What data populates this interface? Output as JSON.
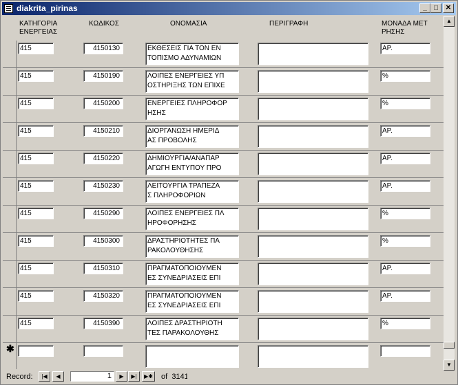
{
  "window": {
    "title": "diakrita_pirinas",
    "minimize": "_",
    "maximize": "□",
    "close": "✕"
  },
  "headers": {
    "category": "ΚΑΤΗΓΟΡΙΑ\nΕΝΕΡΓΕΙΑΣ",
    "code": "ΚΩΔΙΚΟΣ",
    "name": "ΟΝΟΜΑΣΙΑ",
    "description": "ΠΕΡΙΓΡΑΦΗ",
    "unit": "ΜΟΝΑΔΑ ΜΕΤ\nΡΗΣΗΣ"
  },
  "rows": [
    {
      "category": "415",
      "code": "4150130",
      "name": "ΕΚΘΕΣΕΙΣ ΓΙΑ ΤΟΝ ΕΝ\nΤΟΠΙΣΜΟ ΑΔΥΝΑΜΙΩΝ",
      "description": "",
      "unit": "ΑΡ."
    },
    {
      "category": "415",
      "code": "4150190",
      "name": "ΛΟΙΠΕΣ ΕΝΕΡΓΕΙΕΣ ΥΠ\nΟΣΤΗΡΙΞΗΣ ΤΩΝ ΕΠΙΧΕ",
      "description": "",
      "unit": "%"
    },
    {
      "category": "415",
      "code": "4150200",
      "name": "ΕΝΕΡΓΕΙΕΣ ΠΛΗΡΟΦΟΡ\nΗΣΗΣ",
      "description": "",
      "unit": "%"
    },
    {
      "category": "415",
      "code": "4150210",
      "name": "ΔΙΟΡΓΑΝΩΣΗ ΗΜΕΡΙΔ\nΑΣ ΠΡΟΒΟΛΗΣ",
      "description": "",
      "unit": "ΑΡ."
    },
    {
      "category": "415",
      "code": "4150220",
      "name": "ΔΗΜΙΟΥΡΓΙΑ/ΑΝΑΠΑΡ\nΑΓΩΓΗ ΕΝΤΥΠΟΥ ΠΡΟ",
      "description": "",
      "unit": "ΑΡ."
    },
    {
      "category": "415",
      "code": "4150230",
      "name": "ΛΕΙΤΟΥΡΓΙΑ ΤΡΑΠΕΖΑ\nΣ ΠΛΗΡΟΦΟΡΙΩΝ",
      "description": "",
      "unit": "ΑΡ."
    },
    {
      "category": "415",
      "code": "4150290",
      "name": "ΛΟΙΠΕΣ ΕΝΕΡΓΕΙΕΣ ΠΛ\nΗΡΟΦΟΡΗΣΗΣ",
      "description": "",
      "unit": "%"
    },
    {
      "category": "415",
      "code": "4150300",
      "name": "ΔΡΑΣΤΗΡΙΟΤΗΤΕΣ ΠΑ\nΡΑΚΟΛΟΥΘΗΣΗΣ",
      "description": "",
      "unit": "%"
    },
    {
      "category": "415",
      "code": "4150310",
      "name": "ΠΡΑΓΜΑΤΟΠΟΙΟΥΜΕΝ\nΕΣ ΣΥΝΕΔΡΙΑΣΕΙΣ ΕΠΙ",
      "description": "",
      "unit": "ΑΡ."
    },
    {
      "category": "415",
      "code": "4150320",
      "name": "ΠΡΑΓΜΑΤΟΠΟΙΟΥΜΕΝ\nΕΣ ΣΥΝΕΔΡΙΑΣΕΙΣ ΕΠΙ",
      "description": "",
      "unit": "ΑΡ."
    },
    {
      "category": "415",
      "code": "4150390",
      "name": "ΛΟΙΠΕΣ ΔΡΑΣΤΗΡΙΟΤΗ\nΤΕΣ ΠΑΡΑΚΟΛΟΥΘΗΣ",
      "description": "",
      "unit": "%"
    }
  ],
  "new_record_marker": "✱",
  "navigation": {
    "record_label": "Record:",
    "current_record": "1",
    "of_label": "of",
    "total_records": "3141",
    "first": "|◀",
    "prev": "◀",
    "next": "▶",
    "last": "▶|",
    "new": "▶✱"
  },
  "scroll": {
    "up": "▲",
    "down": "▼"
  }
}
